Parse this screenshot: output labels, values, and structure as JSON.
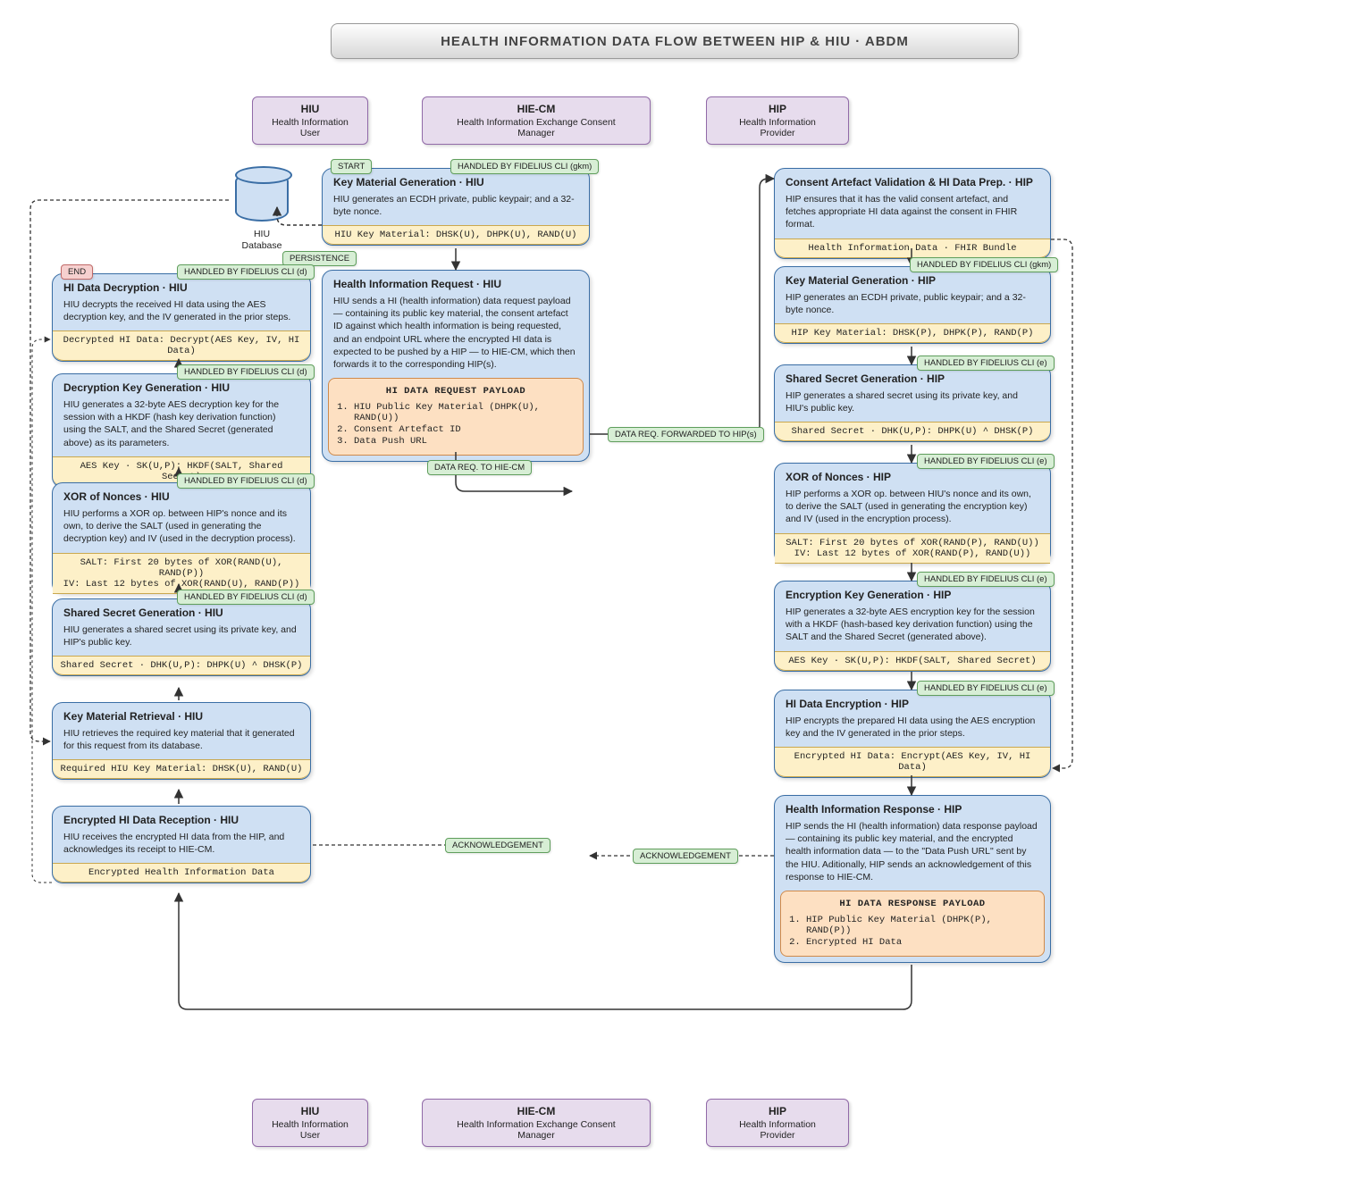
{
  "title": "HEALTH INFORMATION DATA FLOW BETWEEN HIP & HIU · ABDM",
  "participants": {
    "hiu": {
      "title": "HIU",
      "sub": "Health Information User"
    },
    "hiecm": {
      "title": "HIE-CM",
      "sub": "Health Information Exchange Consent Manager"
    },
    "hip": {
      "title": "HIP",
      "sub": "Health Information Provider"
    }
  },
  "db": {
    "line1": "HIU",
    "line2": "Database"
  },
  "tags": {
    "start": "START",
    "end": "END",
    "gkm": "HANDLED BY FIDELIUS CLI (gkm)",
    "d": "HANDLED BY FIDELIUS CLI (d)",
    "e": "HANDLED BY FIDELIUS CLI (e)",
    "persistence": "PERSISTENCE",
    "req_hiecm": "DATA REQ. TO HIE-CM",
    "req_fwd": "DATA REQ. FORWARDED TO HIP(s)",
    "ack": "ACKNOWLEDGEMENT"
  },
  "center": {
    "keymat": {
      "title": "Key Material Generation · HIU",
      "body": "HIU generates an ECDH private, public keypair; and a 32-byte nonce.",
      "band": "HIU Key Material: DHSK(U), DHPK(U), RAND(U)"
    },
    "req": {
      "title": "Health Information Request · HIU",
      "body": "HIU sends a HI (health information) data request payload — containing its public key material, the consent artefact ID against which health information is being requested, and an endpoint URL where the encrypted HI data is expected to be pushed by a HIP — to HIE-CM, which then forwards it to the corresponding HIP(s).",
      "payload_title": "HI DATA REQUEST PAYLOAD",
      "items": [
        "HIU Public Key Material (DHPK(U), RAND(U))",
        "Consent Artefact ID",
        "Data Push URL"
      ]
    }
  },
  "hip": {
    "consent": {
      "title": "Consent Artefact Validation & HI Data Prep. · HIP",
      "body": "HIP ensures that it has the valid consent artefact, and fetches appropriate HI data against the consent in FHIR format.",
      "band": "Health Information Data · FHIR Bundle"
    },
    "keymat": {
      "title": "Key Material Generation · HIP",
      "body": "HIP generates an ECDH private, public keypair; and a 32-byte nonce.",
      "band": "HIP Key Material: DHSK(P), DHPK(P), RAND(P)"
    },
    "shared": {
      "title": "Shared Secret Generation · HIP",
      "body": "HIP generates a shared secret using its private key, and HIU's public key.",
      "band": "Shared Secret · DHK(U,P): DHPK(U) ^ DHSK(P)"
    },
    "xor": {
      "title": "XOR of Nonces · HIP",
      "body": "HIP performs a XOR op. between HIU's nonce and its own, to derive the SALT (used in generating the encryption key) and IV (used in the encryption process).",
      "band1": "SALT: First 20 bytes of XOR(RAND(P), RAND(U))",
      "band2": "IV: Last 12 bytes of XOR(RAND(P), RAND(U))"
    },
    "enckey": {
      "title": "Encryption Key Generation · HIP",
      "body": "HIP generates a 32-byte AES encryption key for the session with a HKDF (hash-based key derivation function) using the SALT and the Shared Secret (generated above).",
      "band": "AES Key · SK(U,P): HKDF(SALT, Shared Secret)"
    },
    "encrypt": {
      "title": "HI Data Encryption · HIP",
      "body": "HIP encrypts the prepared HI data using the AES encryption key and the IV generated in the prior steps.",
      "band": "Encrypted HI Data: Encrypt(AES Key, IV, HI Data)"
    },
    "resp": {
      "title": "Health Information Response · HIP",
      "body": "HIP sends the HI (health information) data response payload — containing its public key material, and the encrypted health information data — to the \"Data Push URL\" sent by the HIU. Aditionally, HIP sends an acknowledgement of this response to HIE-CM.",
      "payload_title": "HI DATA RESPONSE PAYLOAD",
      "items": [
        "HIP Public Key Material (DHPK(P), RAND(P))",
        "Encrypted HI Data"
      ]
    }
  },
  "hiu": {
    "decrypt": {
      "title": "HI Data Decryption · HIU",
      "body": "HIU decrypts the received HI data using the AES decryption key, and the IV generated in the prior steps.",
      "band": "Decrypted HI Data: Decrypt(AES Key, IV, HI Data)"
    },
    "deckey": {
      "title": "Decryption Key Generation · HIU",
      "body": "HIU generates a 32-byte AES decryption key for the session with a HKDF (hash key derivation function) using the SALT, and the Shared Secret (generated above) as its parameters.",
      "band": "AES Key · SK(U,P): HKDF(SALT, Shared Secret)"
    },
    "xor": {
      "title": "XOR of Nonces · HIU",
      "body": "HIU performs a XOR op. between HIP's nonce and its own, to derive the SALT (used in generating the decryption key) and IV (used in the decryption process).",
      "band1": "SALT: First 20 bytes of XOR(RAND(U), RAND(P))",
      "band2": "IV: Last 12 bytes of XOR(RAND(U), RAND(P))"
    },
    "shared": {
      "title": "Shared Secret Generation · HIU",
      "body": "HIU generates a shared secret using its private key, and HIP's public key.",
      "band": "Shared Secret · DHK(U,P): DHPK(U) ^ DHSK(P)"
    },
    "retrieve": {
      "title": "Key Material Retrieval · HIU",
      "body": "HIU retrieves the required key material that it generated for this request from its database.",
      "band": "Required HIU Key Material: DHSK(U), RAND(U)"
    },
    "recv": {
      "title": "Encrypted HI Data Reception · HIU",
      "body": "HIU receives the encrypted HI data from the HIP, and acknowledges its receipt to HIE-CM.",
      "band": "Encrypted Health Information Data"
    }
  }
}
